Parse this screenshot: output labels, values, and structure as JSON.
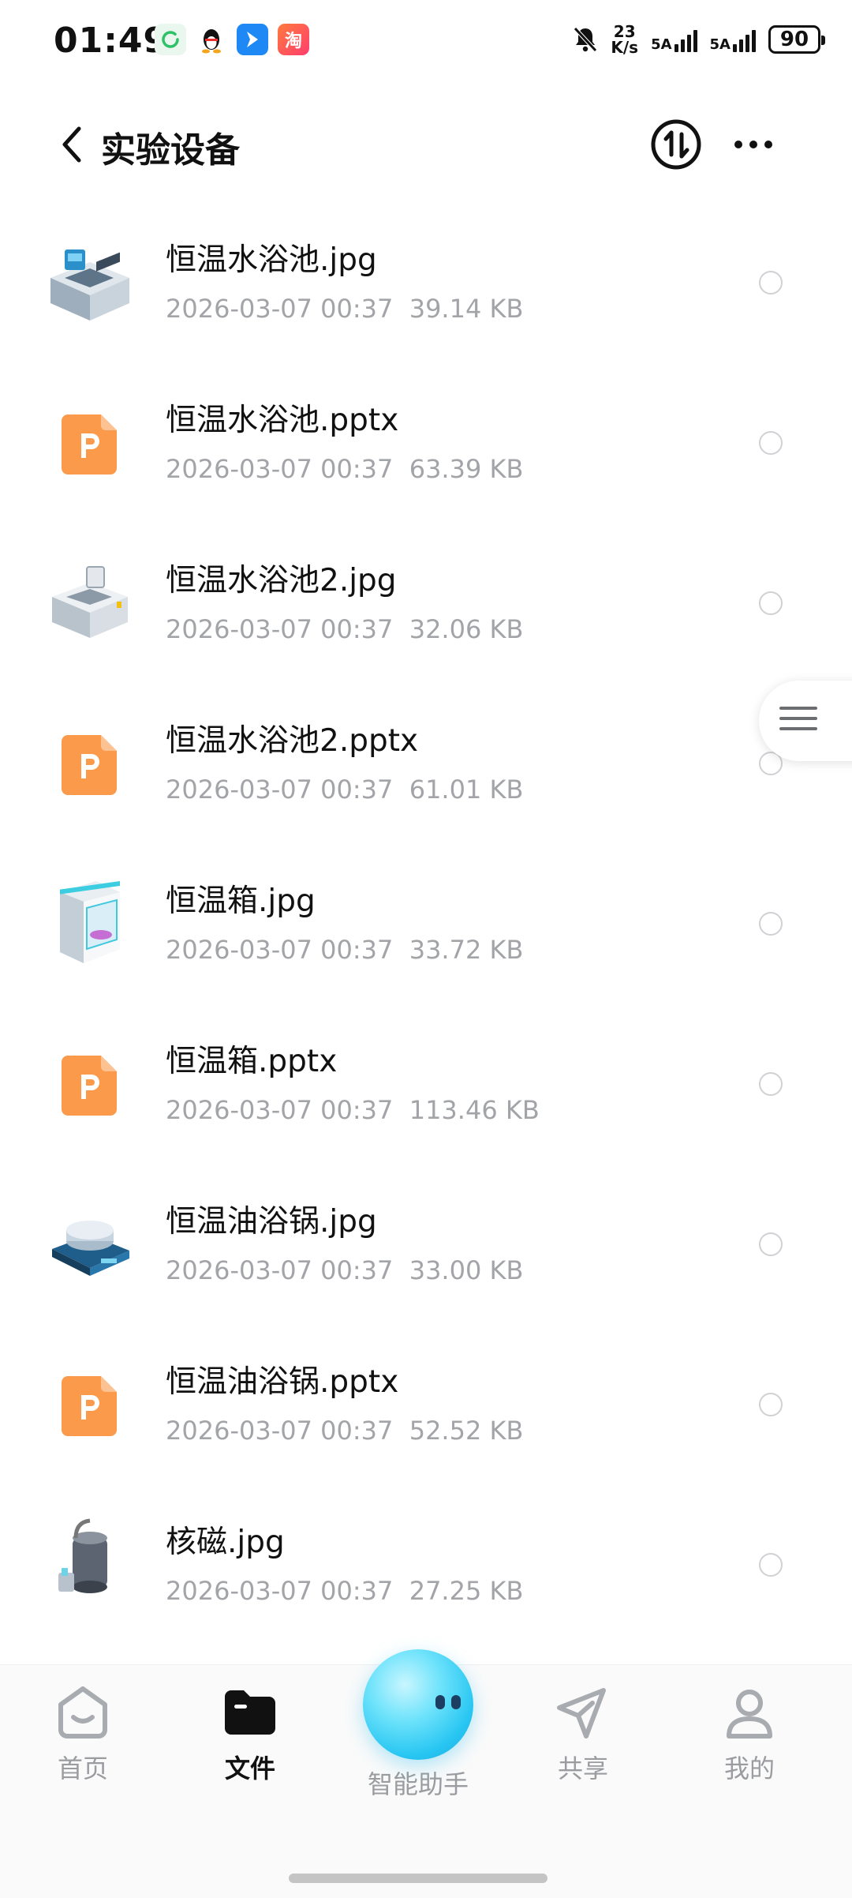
{
  "status_bar": {
    "time": "01:49",
    "net_speed_value": "23",
    "net_speed_unit": "K/s",
    "signal1": "5A",
    "signal2": "5A",
    "battery": "90",
    "app_icons": [
      "refresh-app-icon",
      "qq-penguin-icon",
      "tencent-maps-icon",
      "taobao-icon"
    ],
    "taobao_label": "淘"
  },
  "header": {
    "title": "实验设备"
  },
  "files": [
    {
      "name": "恒温水浴池.jpg",
      "date": "2026-03-07 00:37",
      "size": "39.14 KB",
      "type": "jpg",
      "thumb": "water-bath-thumb"
    },
    {
      "name": "恒温水浴池.pptx",
      "date": "2026-03-07 00:37",
      "size": "63.39 KB",
      "type": "pptx"
    },
    {
      "name": "恒温水浴池2.jpg",
      "date": "2026-03-07 00:37",
      "size": "32.06 KB",
      "type": "jpg",
      "thumb": "water-bath-2-thumb"
    },
    {
      "name": "恒温水浴池2.pptx",
      "date": "2026-03-07 00:37",
      "size": "61.01 KB",
      "type": "pptx"
    },
    {
      "name": "恒温箱.jpg",
      "date": "2026-03-07 00:37",
      "size": "33.72 KB",
      "type": "jpg",
      "thumb": "incubator-thumb"
    },
    {
      "name": "恒温箱.pptx",
      "date": "2026-03-07 00:37",
      "size": "113.46 KB",
      "type": "pptx"
    },
    {
      "name": "恒温油浴锅.jpg",
      "date": "2026-03-07 00:37",
      "size": "33.00 KB",
      "type": "jpg",
      "thumb": "oil-bath-thumb"
    },
    {
      "name": "恒温油浴锅.pptx",
      "date": "2026-03-07 00:37",
      "size": "52.52 KB",
      "type": "pptx"
    },
    {
      "name": "核磁.jpg",
      "date": "2026-03-07 00:37",
      "size": "27.25 KB",
      "type": "jpg",
      "thumb": "nmr-thumb"
    }
  ],
  "bottom_nav": {
    "items": [
      {
        "label": "首页",
        "icon": "home-icon",
        "active": false
      },
      {
        "label": "文件",
        "icon": "folder-icon",
        "active": true
      },
      {
        "label": "智能助手",
        "icon": "assistant-orb-icon",
        "active": false
      },
      {
        "label": "共享",
        "icon": "share-send-icon",
        "active": false
      },
      {
        "label": "我的",
        "icon": "profile-icon",
        "active": false
      }
    ]
  },
  "colors": {
    "pptx_orange": "#fb9a4b",
    "meta_gray": "#a2a4a8",
    "active_text": "#111111",
    "inactive_text": "#9a9ca0"
  }
}
